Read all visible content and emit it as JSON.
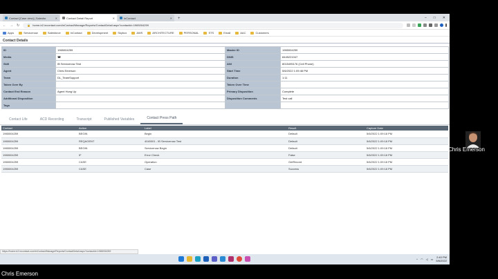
{
  "browser": {
    "tabs": [
      {
        "label": "Contact [Case view] | Salesfor",
        "active": false
      },
      {
        "label": "Contact Detail Report",
        "active": true
      },
      {
        "label": "inContact",
        "active": false
      }
    ],
    "new_tab": "+",
    "window_controls": [
      "–",
      "□",
      "✕"
    ],
    "url": "home-b2.incontact.com/inContact/Manage/Reports/ContactDetail.aspx?contactid=1965004259"
  },
  "bookmarks": [
    {
      "label": "Apps"
    },
    {
      "label": "Servicenow"
    },
    {
      "label": "Salesforce"
    },
    {
      "label": "inContact"
    },
    {
      "label": "Development"
    },
    {
      "label": "Skybox"
    },
    {
      "label": "AWS"
    },
    {
      "label": "ARCHITECTURE"
    },
    {
      "label": "PERSONAL"
    },
    {
      "label": "STS"
    },
    {
      "label": "Email"
    },
    {
      "label": "AAC"
    },
    {
      "label": "Customers"
    }
  ],
  "page": {
    "title": "Contact Details"
  },
  "details": [
    {
      "l1": "ID",
      "v1": "1965004259",
      "l2": "Master ID",
      "v2": "1965004259"
    },
    {
      "l1": "Media",
      "v1": "☎",
      "l2": "DNIS",
      "v2": "8445221047"
    },
    {
      "l1": "Skill",
      "v1": "IB Servicenow Test",
      "l2": "ANI",
      "v2": "8015495176 (Cell Phone)"
    },
    {
      "l1": "Agent",
      "v1": "Chris Emerson",
      "l2": "Start Time",
      "v2": "5/6/2022 1:09:48 PM"
    },
    {
      "l1": "Team",
      "v1": "DL_TeamSupport",
      "l2": "Duration",
      "v2": "1:11"
    },
    {
      "l1": "Taken Over By",
      "v1": "",
      "l2": "Taken Over Time",
      "v2": ""
    },
    {
      "l1": "Contact End Reason",
      "v1": "Agent Hung Up",
      "l2": "Primary Disposition",
      "v2": "Complete"
    },
    {
      "l1": "Additional Disposition",
      "v1": "",
      "l2": "Disposition Comments",
      "v2": "Test call"
    },
    {
      "l1": "Tags",
      "v1": "",
      "l2": "",
      "v2": ""
    }
  ],
  "subtabs": [
    {
      "label": "Contact Life",
      "active": false
    },
    {
      "label": "ACD Recording",
      "active": false
    },
    {
      "label": "Transcript",
      "active": false
    },
    {
      "label": "Published Variables",
      "active": false
    },
    {
      "label": "Contact Press Path",
      "active": true
    }
  ],
  "grid": {
    "columns": [
      "Contact",
      "Action",
      "Label",
      "Result",
      "Capture Date"
    ],
    "rows": [
      [
        "1965004259",
        "BEGIN",
        "Begin",
        "Default",
        "5/6/2022 1:09:18 PM"
      ],
      [
        "1965004259",
        "REQAGENT",
        "4040001 - IB Servicenow Test",
        "Default",
        "5/6/2022 1:09:18 PM"
      ],
      [
        "1965004259",
        "BEGIN",
        "Servicenow Begin",
        "Default",
        "5/6/2022 1:09:18 PM"
      ],
      [
        "1965004259",
        "IF",
        "Error Check",
        "False",
        "5/6/2022 1:09:18 PM"
      ],
      [
        "1965004259",
        "CASE",
        "Operation",
        "GetRecord",
        "5/6/2022 1:09:18 PM"
      ],
      [
        "1965004259",
        "CASE",
        "Case",
        "Success",
        "5/6/2022 1:09:18 PM"
      ]
    ]
  },
  "status_url": "https://home-b2.incontact.com/inContact/Manage/Reports/ContactDetail.aspx?contactid=1965004259",
  "taskbar": {
    "time": "2:40 PM",
    "date": "5/6/2022",
    "tray_chevron": "^"
  },
  "webcam": {
    "name": "Chris Emerson"
  },
  "presenter": {
    "name": "Chris Emerson"
  },
  "colors": {
    "accent": "#5a6775",
    "label_bg": "#b9c5d3"
  }
}
